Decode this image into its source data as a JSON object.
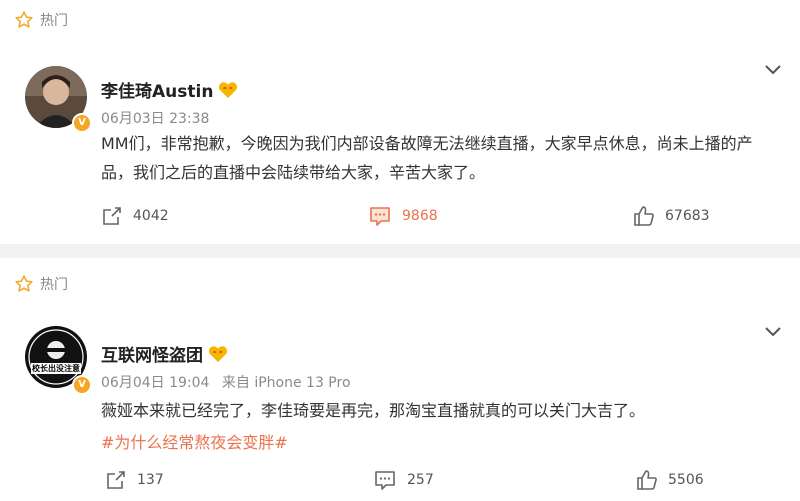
{
  "posts": [
    {
      "tag": "热门",
      "author": "李佳琦Austin",
      "date": "06月03日 23:38",
      "source": "",
      "body": "MM们，非常抱歉，今晚因为我们内部设备故障无法继续直播，大家早点休息，尚未上播的产品，我们之后的直播中会陆续带给大家，辛苦大家了。",
      "hashtag": "",
      "reposts": "4042",
      "comments": "9868",
      "likes": "67683"
    },
    {
      "tag": "热门",
      "author": "互联网怪盗团",
      "date": "06月04日 19:04",
      "source": "来自 iPhone 13 Pro",
      "body": "薇娅本来就已经完了，李佳琦要是再完，那淘宝直播就真的可以关门大吉了。",
      "hashtag": "#为什么经常熬夜会变胖#",
      "avatar_text": "校长出没注意",
      "reposts": "137",
      "comments": "257",
      "likes": "5506"
    }
  ],
  "colors": {
    "accent": "#eb7350",
    "verified": "#f5a623",
    "muted": "#8a8a8a"
  }
}
